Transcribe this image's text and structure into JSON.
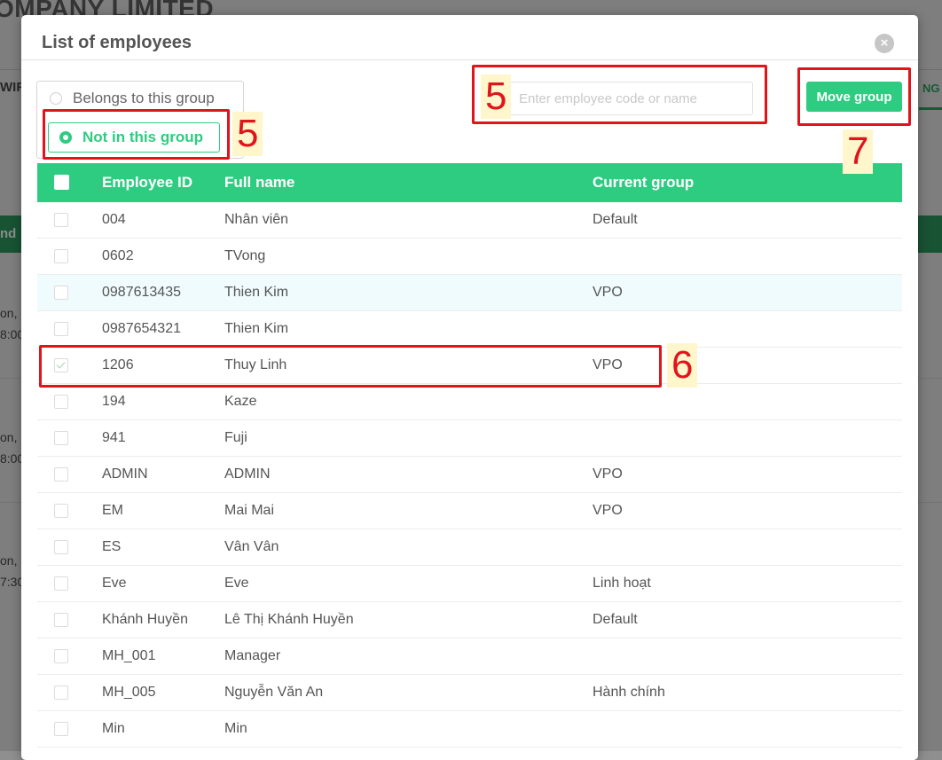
{
  "background": {
    "company_title": "OMPANY LIMITED",
    "left_tab": "WIF",
    "right_tab": "NG C",
    "green_bar_text": "nd",
    "snippets": [
      {
        "line1": "on,",
        "line2": "8:00"
      },
      {
        "line1": "on,",
        "line2": "8:00"
      },
      {
        "line1": "on,",
        "line2": "7:30"
      }
    ]
  },
  "modal": {
    "title": "List of employees",
    "close_icon": "×"
  },
  "filter": {
    "option_belongs": "Belongs to this group",
    "option_not_in": "Not in this group",
    "selected": "Not in this group"
  },
  "search": {
    "placeholder": "Enter employee code or name",
    "value": ""
  },
  "move_button": "Move group",
  "table": {
    "headers": {
      "id": "Employee ID",
      "name": "Full name",
      "group": "Current group"
    },
    "rows": [
      {
        "id": "004",
        "name": "Nhân viên",
        "group": "Default",
        "checked": false
      },
      {
        "id": "0602",
        "name": "TVong",
        "group": "",
        "checked": false
      },
      {
        "id": "0987613435",
        "name": "Thien Kim",
        "group": "VPO",
        "checked": false
      },
      {
        "id": "0987654321",
        "name": "Thien Kim",
        "group": "",
        "checked": false
      },
      {
        "id": "1206",
        "name": "Thuy Linh",
        "group": "VPO",
        "checked": true
      },
      {
        "id": "194",
        "name": "Kaze",
        "group": "",
        "checked": false
      },
      {
        "id": "941",
        "name": "Fuji",
        "group": "",
        "checked": false
      },
      {
        "id": "ADMIN",
        "name": "ADMIN",
        "group": "VPO",
        "checked": false
      },
      {
        "id": "EM",
        "name": "Mai Mai",
        "group": "VPO",
        "checked": false
      },
      {
        "id": "ES",
        "name": "Vân Vân",
        "group": "",
        "checked": false
      },
      {
        "id": "Eve",
        "name": "Eve",
        "group": "Linh hoạt",
        "checked": false
      },
      {
        "id": "Khánh Huyền",
        "name": "Lê Thị Khánh Huyền",
        "group": "Default",
        "checked": false
      },
      {
        "id": "MH_001",
        "name": "Manager",
        "group": "",
        "checked": false
      },
      {
        "id": "MH_005",
        "name": "Nguyễn Văn An",
        "group": "Hành chính",
        "checked": false
      },
      {
        "id": "Min",
        "name": "Min",
        "group": "",
        "checked": false
      }
    ]
  },
  "annotations": {
    "filter_number": "5",
    "search_number": "5",
    "row_number": "6",
    "button_number": "7"
  },
  "colors": {
    "accent": "#2ecc81",
    "annotation": "#e0141b",
    "annotation_label_bg": "#fff6cc"
  }
}
